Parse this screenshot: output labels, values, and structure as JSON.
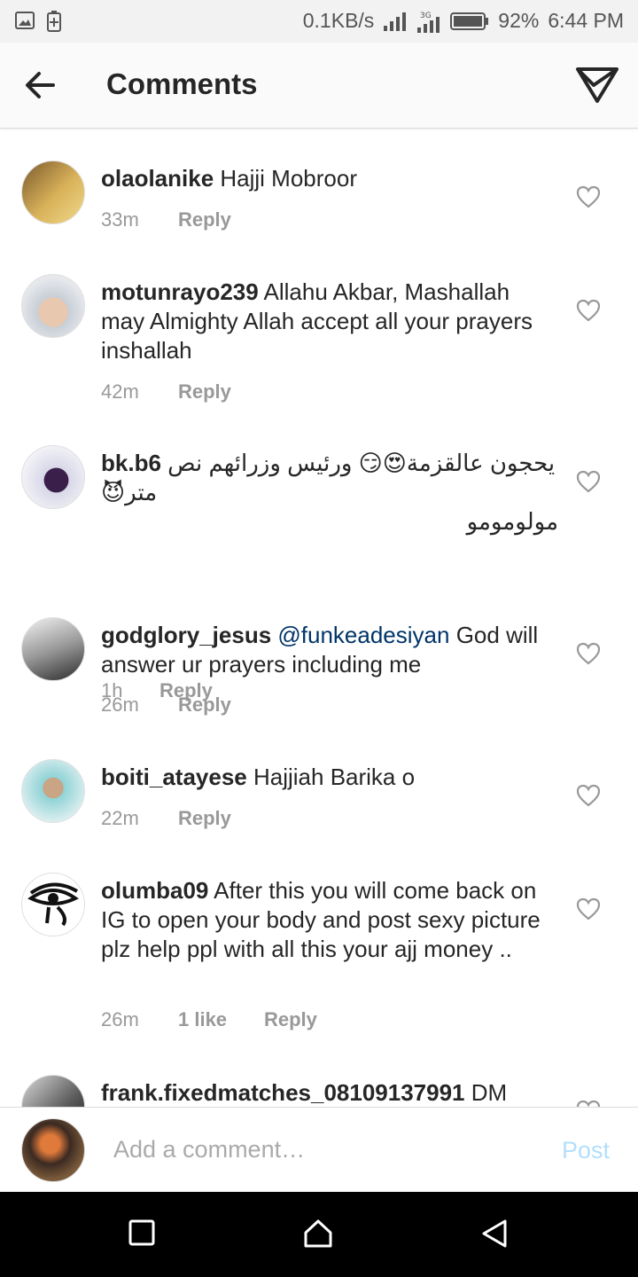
{
  "status_bar": {
    "network_speed": "0.1KB/s",
    "battery": "92%",
    "time": "6:44 PM",
    "icons": [
      "gallery-icon",
      "battery-saver-icon",
      "signal-icon",
      "signal-3g-icon",
      "battery-icon"
    ]
  },
  "header": {
    "title": "Comments",
    "back_icon": "arrow-left-icon",
    "direct_icon": "paper-plane-icon"
  },
  "comments": [
    {
      "username": "olaolanike",
      "text": "Hajji Mobroor",
      "time": "33m",
      "likes": "",
      "reply": "Reply"
    },
    {
      "username": "motunrayo239",
      "text": "Allahu Akbar, Mashallah may Almighty Allah accept all your prayers inshallah",
      "time": "42m",
      "likes": "",
      "reply": "Reply"
    },
    {
      "username": "bk.b6",
      "text": "يحجون عالقزمة😍😏 ورئيس وزرائهم نص متر😈",
      "text2": "مولومومو",
      "time": "1h",
      "likes": "",
      "reply": "Reply"
    },
    {
      "username": "godglory_jesus",
      "mention": "@funkeadesiyan",
      "text": "God will answer ur prayers including me",
      "time": "26m",
      "likes": "",
      "reply": "Reply"
    },
    {
      "username": "boiti_atayese",
      "text": "Hajjiah Barika o",
      "time": "22m",
      "likes": "",
      "reply": "Reply"
    },
    {
      "username": "olumba09",
      "text": "After this you will come back on IG to  open your body and post sexy picture plz help ppl with all this your ajj money ..",
      "time": "26m",
      "likes": "1 like",
      "reply": "Reply"
    },
    {
      "username": "frank.fixedmatches_08109137991",
      "text": "DM",
      "time": "",
      "likes": "",
      "reply": ""
    }
  ],
  "composer": {
    "placeholder": "Add a comment…",
    "post_label": "Post"
  },
  "nav_bar": {
    "icons": [
      "recent-apps-icon",
      "home-icon",
      "back-icon"
    ]
  },
  "colors": {
    "text": "#262626",
    "meta": "#999999",
    "mention": "#003569",
    "post_disabled": "#b2dffc"
  }
}
